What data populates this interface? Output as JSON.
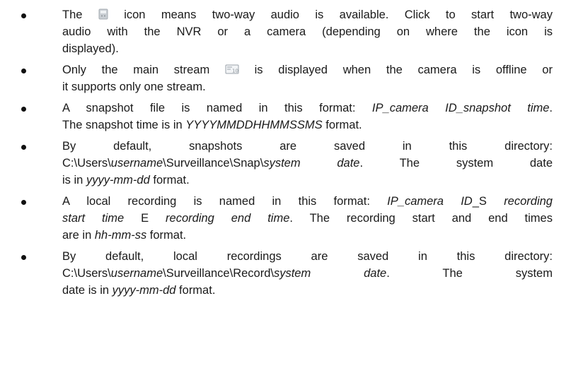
{
  "notes": {
    "two_way_audio": {
      "prefix": "The",
      "icon": "two-way-audio-icon",
      "line1_rest": "icon means two-way audio is available. Click to start two-way",
      "line2": "audio with the NVR or a camera (depending on where the icon is",
      "line3": "displayed)."
    },
    "main_stream": {
      "prefix": "Only the main stream",
      "icon": "main-stream-icon",
      "line1_rest": "is displayed when the camera is offline or",
      "line2": "it supports only one stream."
    },
    "snapshot_name": {
      "prefix": "A snapshot file is named in this format: ",
      "format": "IP_camera ID_snapshot time",
      "end": ".",
      "line2_prefix": "The snapshot time is in ",
      "line2_format": "YYYYMMDDHHMMSSMS",
      "line2_suffix": " format."
    },
    "snapshot_dir": {
      "line1": "By default, snapshots are saved in this directory:",
      "path_prefix": "C:\\Users\\",
      "path_user": "username",
      "path_middle": "\\Surveillance\\Snap\\",
      "path_date": "system date",
      "path_end": ". The system date",
      "line3_prefix": "is in ",
      "line3_format": "yyyy-mm-dd",
      "line3_suffix": " format."
    },
    "recording_name": {
      "prefix": "A local recording is named in this format: ",
      "format": "IP_camera ID",
      "s_marker": "_S ",
      "format_start": "recording",
      "line2_format_start": "start time",
      "e_marker": " E ",
      "format_end": "recording end time",
      "line2_suffix": ". The recording start and end times",
      "line3_prefix": "are in ",
      "line3_format": "hh-mm-ss",
      "line3_suffix": " format."
    },
    "recording_dir": {
      "line1": "By default, local recordings are saved in this directory:",
      "path_prefix": "C:\\Users\\",
      "path_user": "username",
      "path_middle": "\\Surveillance\\Record\\",
      "path_date": "system date",
      "path_end": ". The system",
      "line3_prefix": "date is in ",
      "line3_format": "yyyy-mm-dd",
      "line3_suffix": " format."
    }
  }
}
